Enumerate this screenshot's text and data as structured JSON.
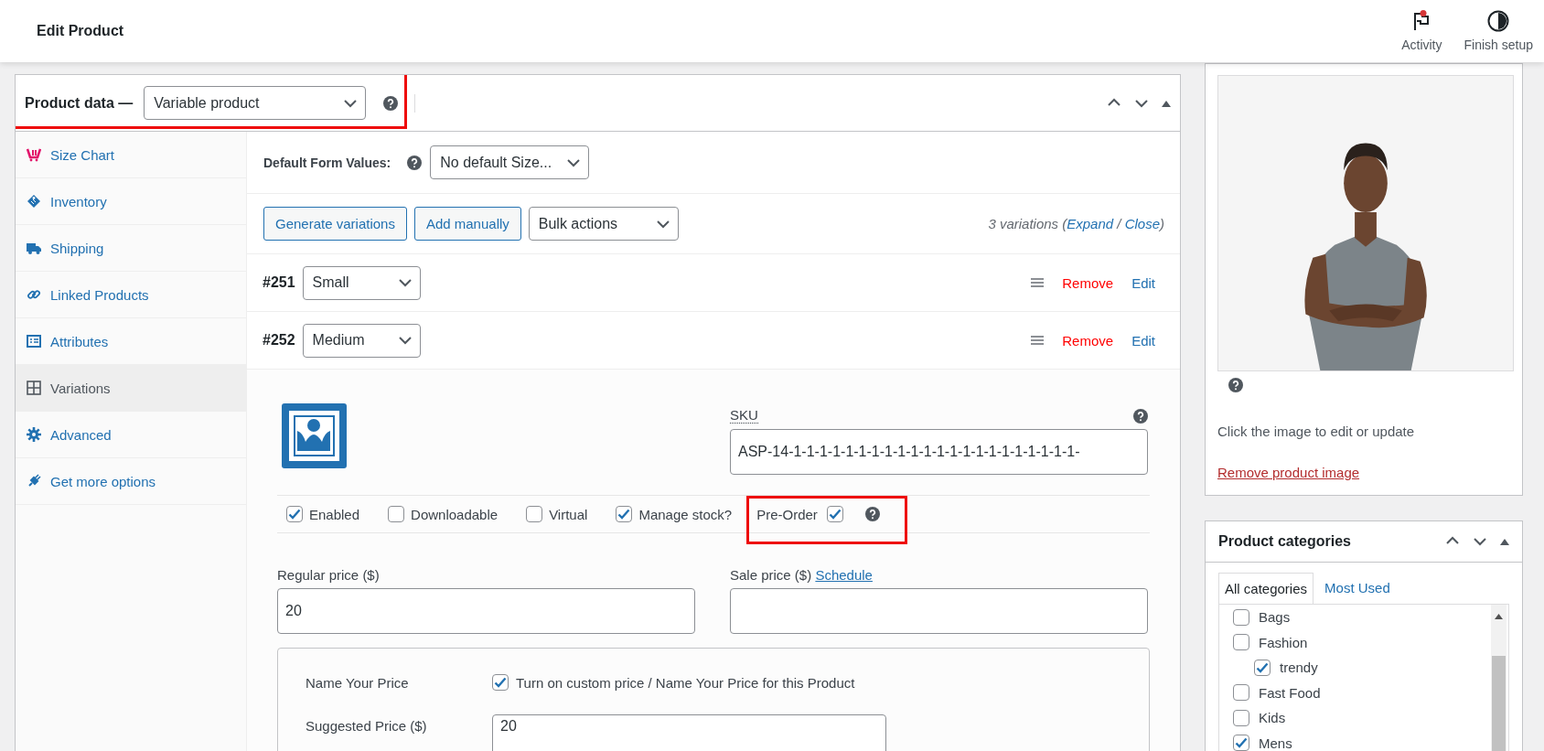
{
  "topbar": {
    "title": "Edit Product",
    "actions": [
      {
        "label": "Activity",
        "notification": true
      },
      {
        "label": "Finish setup"
      }
    ]
  },
  "product_data": {
    "label": "Product data —",
    "product_type": "Variable product",
    "highlighted": true,
    "tabs": [
      {
        "label": "Size Chart",
        "selected": false
      },
      {
        "label": "Inventory",
        "selected": false
      },
      {
        "label": "Shipping",
        "selected": false
      },
      {
        "label": "Linked Products",
        "selected": false
      },
      {
        "label": "Attributes",
        "selected": false
      },
      {
        "label": "Variations",
        "selected": true
      },
      {
        "label": "Advanced",
        "selected": false
      },
      {
        "label": "Get more options",
        "selected": false
      }
    ],
    "default_form": {
      "label": "Default Form Values:",
      "value": "No default Size..."
    },
    "actions": [
      "Generate variations",
      "Add manually"
    ],
    "bulk_actions": "Bulk actions",
    "summary": [
      {
        "text": "3 variations ("
      },
      {
        "link": "Expand"
      },
      {
        "text": " / "
      },
      {
        "link": "Close"
      },
      {
        "text": ")"
      }
    ],
    "variations": [
      {
        "number": "#251",
        "value": "Small",
        "remove": "Remove",
        "edit": "Edit"
      },
      {
        "number": "#252",
        "value": "Medium",
        "remove": "Remove",
        "edit": "Edit",
        "details": {
          "sku": {
            "label": "SKU",
            "value": "ASP-14-1-1-1-1-1-1-1-1-1-1-1-1-1-1-1-1-1-1-1-1-1-1-"
          },
          "options": [
            {
              "label": "Enabled",
              "checked": true
            },
            {
              "label": "Downloadable",
              "checked": false
            },
            {
              "label": "Virtual",
              "checked": false
            },
            {
              "label": "Manage stock?",
              "checked": true
            }
          ],
          "pre_order": {
            "label": "Pre-Order",
            "checked": true,
            "highlighted": true
          },
          "regular_price": {
            "label": "Regular price ($)",
            "value": "20"
          },
          "sale_price": {
            "label": "Sale price ($)",
            "link": "Schedule"
          },
          "name_your_price": {
            "label": "Name Your Price",
            "toggle": {
              "label": "Turn on custom price / Name Your Price for this Product",
              "checked": true
            },
            "suggested": {
              "label": "Suggested Price ($)",
              "value": "20"
            }
          }
        }
      }
    ]
  },
  "product_image": {
    "kind": "picture",
    "hint": "Click the image to edit or update",
    "remove": "Remove product image"
  },
  "categories": {
    "title": "Product categories",
    "tabs": [
      {
        "label": "All categories",
        "selected": true
      },
      {
        "label": "Most Used",
        "selected": false
      }
    ],
    "items": [
      {
        "label": "Bags",
        "checked": false
      },
      {
        "label": "Fashion",
        "checked": false,
        "children": [
          {
            "label": "trendy",
            "checked": true
          }
        ]
      },
      {
        "label": "Fast Food",
        "checked": false
      },
      {
        "label": "Kids",
        "checked": false
      },
      {
        "label": "Mens",
        "checked": true
      }
    ]
  }
}
